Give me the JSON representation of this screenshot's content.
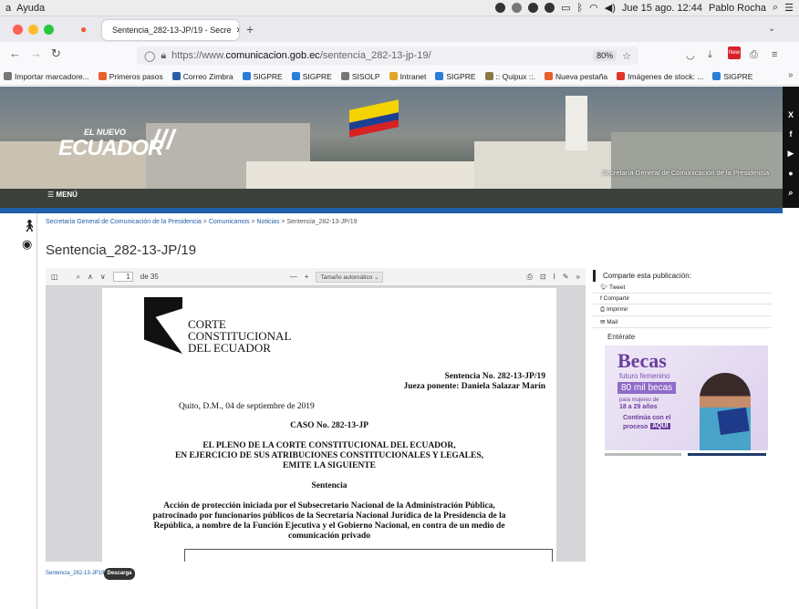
{
  "menubar": {
    "app_menu": "a",
    "help": "Ayuda",
    "clock": "Jue 15 ago. 12:44",
    "user": "Pablo Rocha"
  },
  "tab": {
    "title": "Sentencia_282-13-JP/19 - Secre"
  },
  "url": {
    "prefix": "https://www.",
    "domain": "comunicacion.gob.ec",
    "path": "/sentencia_282-13-jp-19/",
    "zoom": "80%"
  },
  "bookmarks": [
    {
      "label": "Importar marcadore...",
      "color": "#777"
    },
    {
      "label": "Primeros pasos",
      "color": "#e8602a"
    },
    {
      "label": "Correo Zimbra",
      "color": "#2a5ea8"
    },
    {
      "label": "SIGPRE",
      "color": "#2b7ed6"
    },
    {
      "label": "SIGPRE",
      "color": "#2b7ed6"
    },
    {
      "label": "SISOLP",
      "color": "#777"
    },
    {
      "label": "Intranet",
      "color": "#e0a52a"
    },
    {
      "label": "SIGPRE",
      "color": "#2b7ed6"
    },
    {
      "label": ":: Quipux ::.",
      "color": "#8a7a44"
    },
    {
      "label": "Nueva pestaña",
      "color": "#e8602a"
    },
    {
      "label": "Imágenes de stock: ...",
      "color": "#e0342a"
    },
    {
      "label": "SIGPRE",
      "color": "#2b7ed6"
    }
  ],
  "hero": {
    "logo_top": "EL NUEVO",
    "logo_main": "ECUADOR",
    "tagline": "Secretaría General de Comunicación de la Presidencia",
    "menu": "MENÚ"
  },
  "breadcrumb": {
    "part1": "Secretaría General de Comunicación de la Presidencia",
    "sep": " > ",
    "part2": "Comunicamos",
    "part3": "Noticias",
    "current": "Sentencia_282-13-JP/19"
  },
  "page_title": "Sentencia_282-13-JP/19",
  "viewer": {
    "page": "1",
    "of": "de 35",
    "zoom_label": "Tamaño automático"
  },
  "pdf": {
    "org1": "CORTE",
    "org2": "CONSTITUCIONAL",
    "org3": "DEL ECUADOR",
    "ref1": "Sentencia  No. 282-13-JP/19",
    "ref2": "Jueza ponente: Daniela Salazar Marín",
    "date": "Quito, D.M., 04 de septiembre de 2019",
    "case": "CASO No. 282-13-JP",
    "pleno1": "EL PLENO DE LA CORTE CONSTITUCIONAL DEL ECUADOR,",
    "pleno2": "EN EJERCICIO DE SUS ATRIBUCIONES CONSTITUCIONALES Y LEGALES,",
    "pleno3": "EMITE LA SIGUIENTE",
    "sentencia": "Sentencia",
    "abs1": "Acción de protección iniciada por el Subsecretario Nacional de la Administración Pública,",
    "abs2": "patrocinado por funcionarios públicos de la Secretaría Nacional Jurídica de la Presidencia de la",
    "abs3": "República, a nombre de la Función Ejecutiva y el Gobierno Nacional, en contra de un medio de",
    "abs4": "comunicación privado"
  },
  "share": {
    "title": "Comparte esta publicación:",
    "items": [
      "Tweet",
      "Compartir",
      "Imprimir",
      "Mail"
    ]
  },
  "enterate": "Entérate",
  "becas": {
    "title": "Becas",
    "sub": "futuro femenino",
    "count": "80 mil becas",
    "for": "para mujeres de",
    "age": "18 a 29 años",
    "cta1": "Continúa con el",
    "cta2": "proceso",
    "cta3": "AQUÍ"
  },
  "footer": {
    "link": "Sentencia_282-13-JP19",
    "download": "Descarga"
  }
}
